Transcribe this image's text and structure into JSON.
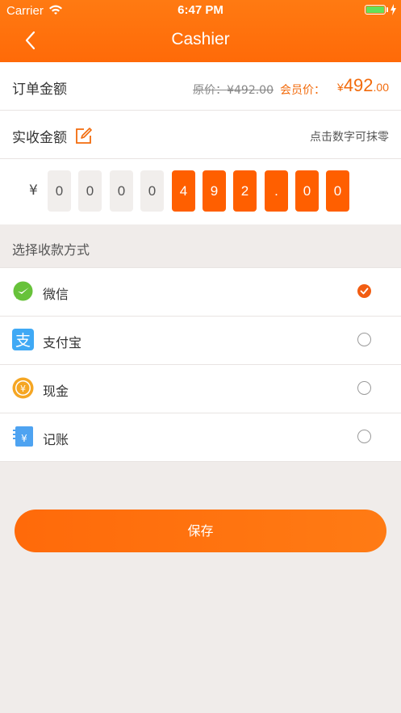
{
  "status_bar": {
    "carrier": "Carrier",
    "time": "6:47 PM"
  },
  "nav": {
    "title": "Cashier"
  },
  "order_amount": {
    "label": "订单金额",
    "original_price_label": "原价：",
    "original_price": "¥492.00",
    "member_price_label": "会员价：",
    "member_price_currency": "¥",
    "member_price_int": "492",
    "member_price_dec": ".00"
  },
  "received_amount": {
    "label": "实收金额",
    "hint": "点击数字可抹零"
  },
  "amount_digits": {
    "currency": "¥",
    "digits": [
      "0",
      "0",
      "0",
      "0",
      "4",
      "9",
      "2",
      ".",
      "0",
      "0"
    ],
    "active_from_index": 4
  },
  "payment": {
    "section_title": "选择收款方式",
    "methods": [
      {
        "label": "微信",
        "icon": "wechat-icon",
        "selected": true
      },
      {
        "label": "支付宝",
        "icon": "alipay-icon",
        "selected": false
      },
      {
        "label": "现金",
        "icon": "cash-icon",
        "selected": false
      },
      {
        "label": "记账",
        "icon": "ledger-icon",
        "selected": false
      }
    ]
  },
  "actions": {
    "save_label": "保存"
  },
  "colors": {
    "accent": "#ff6a08",
    "selected": "#f25d12",
    "background": "#f0ecea"
  }
}
